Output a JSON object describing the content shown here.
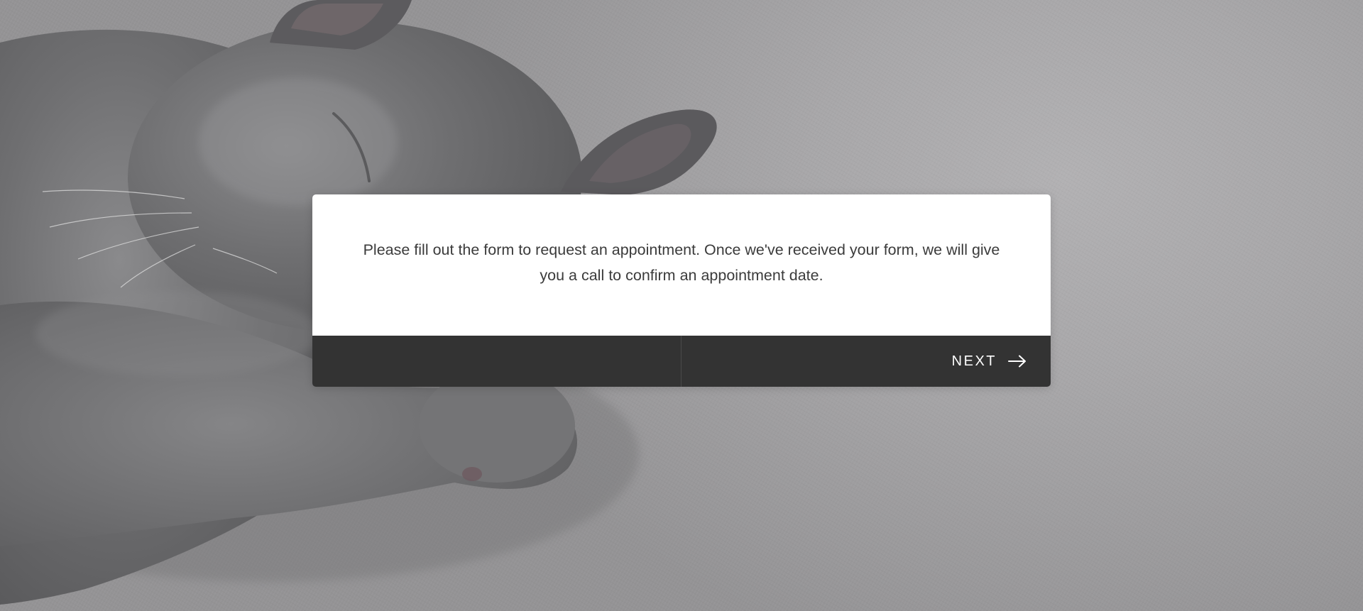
{
  "dialog": {
    "message": "Please fill out the form to request an appointment. Once we've received your form, we will give you a call to confirm an appointment date.",
    "next_label": "NEXT"
  },
  "icons": {
    "next": "arrow-right-icon"
  },
  "colors": {
    "card_background": "#ffffff",
    "footer_background": "#333333",
    "message_text": "#3b3b3b",
    "button_text": "#ffffff"
  }
}
